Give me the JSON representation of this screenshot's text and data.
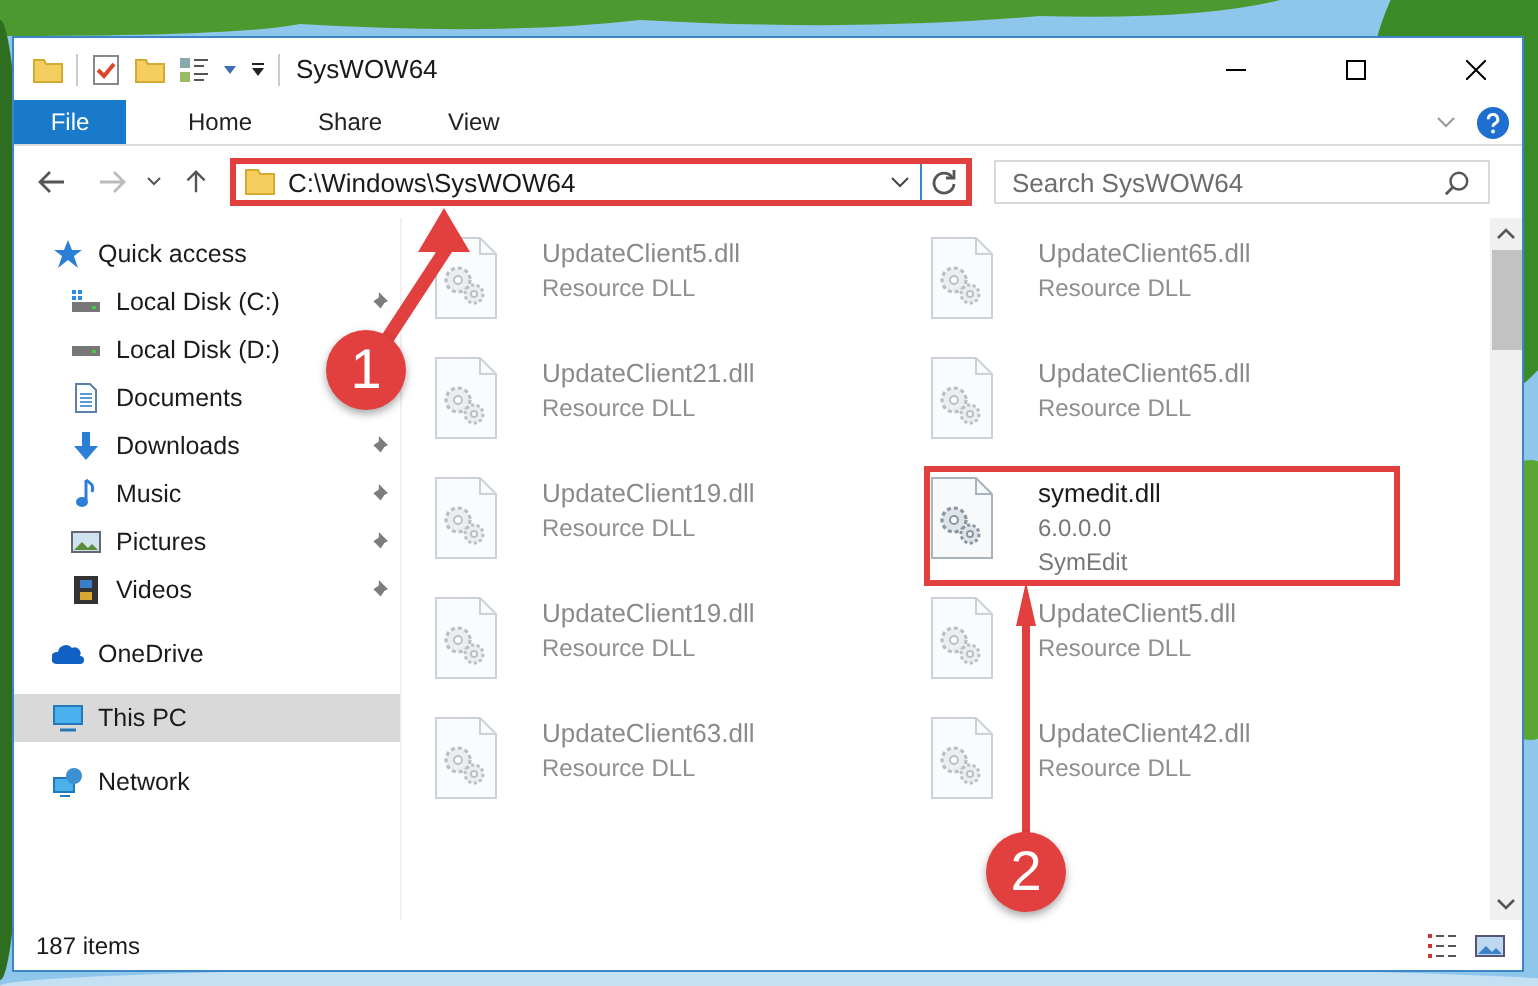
{
  "window": {
    "title": "SysWOW64"
  },
  "ribbon_tabs": [
    {
      "label": "File",
      "kind": "file"
    },
    {
      "label": "Home",
      "kind": "tab"
    },
    {
      "label": "Share",
      "kind": "tab"
    },
    {
      "label": "View",
      "kind": "tab"
    }
  ],
  "address_bar": {
    "path": "C:\\Windows\\SysWOW64",
    "highlighted": true
  },
  "search": {
    "placeholder": "Search SysWOW64"
  },
  "sidebar": {
    "items": [
      {
        "label": "Quick access",
        "kind": "quick-access",
        "selected": false,
        "children": [
          {
            "label": "Local Disk (C:)",
            "kind": "drive-c",
            "pinned": true,
            "selected": false
          },
          {
            "label": "Local Disk (D:)",
            "kind": "drive",
            "pinned": false,
            "selected": false
          },
          {
            "label": "Documents",
            "kind": "documents",
            "pinned": false,
            "selected": false
          },
          {
            "label": "Downloads",
            "kind": "downloads",
            "pinned": true,
            "selected": false
          },
          {
            "label": "Music",
            "kind": "music",
            "pinned": true,
            "selected": false
          },
          {
            "label": "Pictures",
            "kind": "pictures",
            "pinned": true,
            "selected": false
          },
          {
            "label": "Videos",
            "kind": "videos",
            "pinned": true,
            "selected": false
          }
        ]
      },
      {
        "label": "OneDrive",
        "kind": "onedrive",
        "selected": false
      },
      {
        "label": "This PC",
        "kind": "pc",
        "selected": true
      },
      {
        "label": "Network",
        "kind": "network",
        "selected": false
      }
    ]
  },
  "files": [
    {
      "name": "UpdateClient5.dll",
      "details": [
        "Resource DLL"
      ],
      "blurred": true,
      "highlighted": false
    },
    {
      "name": "UpdateClient65.dll",
      "details": [
        "Resource DLL"
      ],
      "blurred": true,
      "highlighted": false
    },
    {
      "name": "UpdateClient21.dll",
      "details": [
        "Resource DLL"
      ],
      "blurred": true,
      "highlighted": false
    },
    {
      "name": "UpdateClient65.dll",
      "details": [
        "Resource DLL"
      ],
      "blurred": true,
      "highlighted": false
    },
    {
      "name": "UpdateClient19.dll",
      "details": [
        "Resource DLL"
      ],
      "blurred": true,
      "highlighted": false
    },
    {
      "name": "symedit.dll",
      "details": [
        "6.0.0.0",
        "SymEdit"
      ],
      "blurred": false,
      "highlighted": true
    },
    {
      "name": "UpdateClient19.dll",
      "details": [
        "Resource DLL"
      ],
      "blurred": true,
      "highlighted": false
    },
    {
      "name": "UpdateClient5.dll",
      "details": [
        "Resource DLL"
      ],
      "blurred": true,
      "highlighted": false
    },
    {
      "name": "UpdateClient63.dll",
      "details": [
        "Resource DLL"
      ],
      "blurred": true,
      "highlighted": false
    },
    {
      "name": "UpdateClient42.dll",
      "details": [
        "Resource DLL"
      ],
      "blurred": true,
      "highlighted": false
    }
  ],
  "status_bar": {
    "item_count": "187 items"
  },
  "annotations": [
    {
      "label": "1"
    },
    {
      "label": "2"
    }
  ]
}
